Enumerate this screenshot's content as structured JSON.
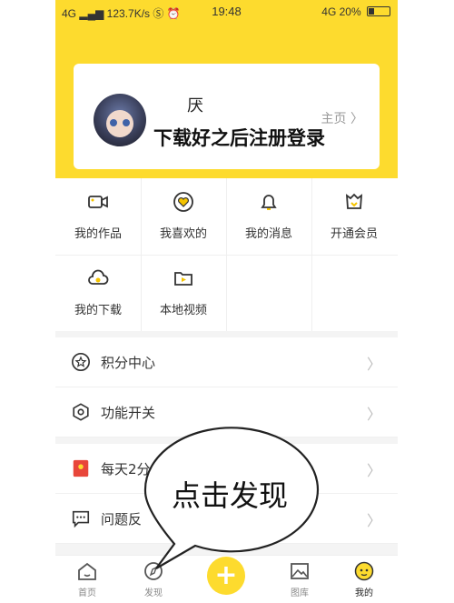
{
  "status_bar": {
    "network": "4G",
    "speed": "123.7K/s",
    "time": "19:48",
    "network_right": "4G",
    "battery": "20%"
  },
  "profile": {
    "username": "厌",
    "overlay_text": "下载好之后注册登录",
    "home_link": "主页 〉"
  },
  "grid": {
    "items": [
      {
        "label": "我的作品",
        "icon": "video-camera-icon"
      },
      {
        "label": "我喜欢的",
        "icon": "heart-badge-icon"
      },
      {
        "label": "我的消息",
        "icon": "bell-icon"
      },
      {
        "label": "开通会员",
        "icon": "vip-shield-icon"
      },
      {
        "label": "我的下载",
        "icon": "cloud-download-icon"
      },
      {
        "label": "本地视频",
        "icon": "local-video-folder-icon"
      }
    ]
  },
  "list": {
    "items": [
      {
        "label": "积分中心",
        "icon": "star-circle-icon"
      },
      {
        "label": "功能开关",
        "icon": "hexagon-settings-icon"
      },
      {
        "label": "每天2分",
        "icon": "red-envelope-icon"
      },
      {
        "label": "问题反",
        "icon": "message-icon"
      }
    ]
  },
  "annotation": {
    "bubble_text": "点击发现"
  },
  "tabbar": {
    "tabs": [
      {
        "label": "首页",
        "icon": "home-icon"
      },
      {
        "label": "发现",
        "icon": "compass-icon"
      },
      {
        "label": "图库",
        "icon": "gallery-icon"
      },
      {
        "label": "我的",
        "icon": "profile-face-icon"
      }
    ],
    "plus": "+"
  },
  "colors": {
    "accent": "#fddb2e",
    "background": "#f4f4f4"
  }
}
